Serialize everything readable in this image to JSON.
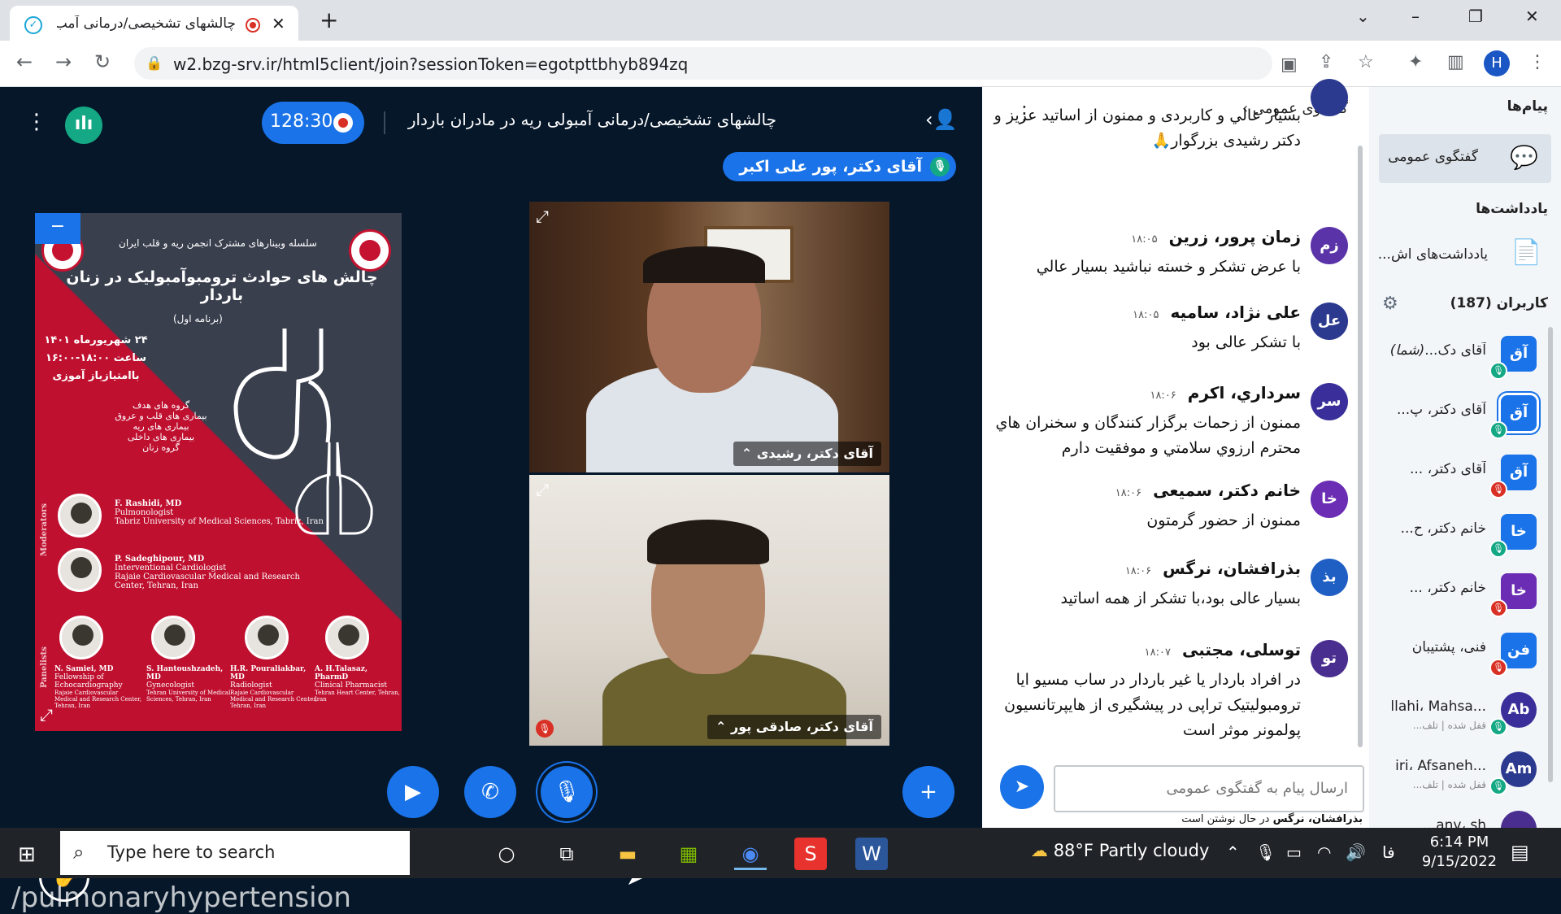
{
  "browser": {
    "tab_title": "چالشهای تشخیصی/درمانی آمب - ",
    "tab_close": "✕",
    "new_tab": "+",
    "url": "w2.bzg-srv.ir/html5client/join?sessionToken=egotpttbhyb894zq",
    "profile_initial": "H"
  },
  "header": {
    "timer": "128:30",
    "meeting_title": "چالشهای تشخیصی/درمانی آمبولی ریه در مادران باردار",
    "talker": "آقای دکتر، پور علی اکبر"
  },
  "presentation": {
    "series": "سلسله وبینارهای مشترک انجمن ریه و قلب ایران",
    "title": "چالش های حوادث ترومبوآمبولیک در زنان باردار",
    "program": "(برنامه اول)",
    "date_lines": [
      "۲۴ شهریورماه ۱۴۰۱",
      "ساعت ۱۸:۰۰-۱۶:۰۰",
      "باامتیازباز آموزی"
    ],
    "target_group_title": "گروه های هدف",
    "target_groups": [
      "بیماری های قلب و عروق",
      "بیماری های ریه",
      "بیماری های داخلی",
      "گروه زنان"
    ],
    "moderators_label": "Moderators",
    "panelists_label": "Panelists",
    "moderators": [
      {
        "name": "F. Rashidi, MD",
        "role": "Pulmonologist",
        "affil": "Tabriz University of Medical Sciences, Tabriz, Iran"
      },
      {
        "name": "P. Sadeghipour, MD",
        "role": "Interventional Cardiologist",
        "affil": "Rajaie Cardiovascular Medical and Research Center, Tehran, Iran"
      }
    ],
    "panelists": [
      {
        "name": "N. Samiei, MD",
        "role": "Fellowship of Echocardiography",
        "affil": "Rajaie Cardiovascular Medical and Research Center, Tehran, Iran"
      },
      {
        "name": "S. Hantoushzadeh, MD",
        "role": "Gynecologist",
        "affil": "Tehran University of Medical Sciences, Tehran, Iran"
      },
      {
        "name": "H.R. Pouraliakbar, MD",
        "role": "Radiologist",
        "affil": "Rajaie Cardiovascular Medical and Research Center, Tehran, Iran"
      },
      {
        "name": "A. H.Talasaz, PharmD",
        "role": "Clinical Pharmacist",
        "affil": "Tehran Heart Center, Tehran, Iran"
      }
    ]
  },
  "cameras": [
    {
      "label": "آقای دکتر، رشیدی"
    },
    {
      "label": "آقای دکتر، صادقی پور"
    }
  ],
  "watermark": "/pulmonaryhypertension",
  "chat": {
    "title": "گفتگوی عمومی",
    "messages": [
      {
        "initials": "",
        "name": "",
        "time": "",
        "text": "بسيار عالي و کاربردی و ممنون از اساتید عزیز و دکتر رشیدی بزرگوار🙏",
        "color": "#2b3a8f"
      },
      {
        "initials": "زم",
        "name": "زمان پرور، زرين",
        "time": "۱۸:۰۵",
        "text": "با عرض تشکر و خسته نباشید بسیار عالي",
        "color": "#5b33a8"
      },
      {
        "initials": "عل",
        "name": "علی نژاد، سامیه",
        "time": "۱۸:۰۵",
        "text": "با تشکر عالی بود",
        "color": "#2b3a8f"
      },
      {
        "initials": "سر",
        "name": "سرداري، اکرم",
        "time": "۱۸:۰۶",
        "text": "ممنون از زحمات برگزار کنندگان و سخنران هاي محترم ارزوي سلامتي و موفقيت دارم",
        "color": "#3a2f9a"
      },
      {
        "initials": "خا",
        "name": "خانم دکتر، سمیعی",
        "time": "۱۸:۰۶",
        "text": "ممنون از حضور گرمتون",
        "color": "#6a2db3"
      },
      {
        "initials": "بذ",
        "name": "بذرافشان، نرگس",
        "time": "۱۸:۰۶",
        "text": "بسیار عالی بود،با تشکر از همه اساتید",
        "color": "#1f5fc4"
      },
      {
        "initials": "تو",
        "name": "توسلی، مجتبی",
        "time": "۱۸:۰۷",
        "text": "در افراد باردار یا غیر باردار در ساب مسیو ایا ترومبولیتیک تراپی در پیشگیری از هایپرتانسیون پولمونر موثر است",
        "color": "#4a2e8f"
      }
    ],
    "input_placeholder": "ارسال پیام به گفتگوی عمومی",
    "typing_name": "بذرافشان، نرگس",
    "typing_suffix": "در حال نوشتن است"
  },
  "sidebar": {
    "messages_title": "پیام‌ها",
    "public_chat": "گفتگوی عمومی",
    "notes_title": "یادداشت‌ها",
    "shared_notes": "یادداشت‌های اش...",
    "users_title": "کاربران (187)",
    "users": [
      {
        "initials": "آق",
        "name": "آقای دک...",
        "you": "(شما)",
        "sub": "",
        "color": "#1a73e8",
        "status": "#15a885",
        "square": true,
        "selected": false
      },
      {
        "initials": "آق",
        "name": "آقای دکتر، پ...",
        "you": "",
        "sub": "",
        "color": "#1a73e8",
        "status": "#15a885",
        "square": true,
        "selected": true
      },
      {
        "initials": "آق",
        "name": "آقای دکتر، ...",
        "you": "",
        "sub": "",
        "color": "#1a73e8",
        "status": "#d93025",
        "square": true,
        "selected": false
      },
      {
        "initials": "خا",
        "name": "خانم دکتر، ح...",
        "you": "",
        "sub": "",
        "color": "#1a73e8",
        "status": "#15a885",
        "square": true,
        "selected": false
      },
      {
        "initials": "خا",
        "name": "خانم دکتر، ...",
        "you": "",
        "sub": "",
        "color": "#6a2db3",
        "status": "#d93025",
        "square": true,
        "selected": false
      },
      {
        "initials": "فن",
        "name": "فنی، پشتیبان",
        "you": "",
        "sub": "",
        "color": "#1a73e8",
        "status": "#d93025",
        "square": true,
        "selected": false
      },
      {
        "initials": "Ab",
        "name": "...llahi، Mahsa",
        "you": "",
        "sub": "قفل شده | تلف...",
        "color": "#3a2f9a",
        "status": "#15a885",
        "square": false,
        "selected": false
      },
      {
        "initials": "Am",
        "name": "...iri، Afsaneh",
        "you": "",
        "sub": "قفل شده | تلف...",
        "color": "#2b3a8f",
        "status": "#15a885",
        "square": false,
        "selected": false
      },
      {
        "initials": "",
        "name": "anv، sh...",
        "you": "",
        "sub": "",
        "color": "#4a2e8f",
        "status": "",
        "square": false,
        "selected": false
      }
    ]
  },
  "taskbar": {
    "search_placeholder": "Type here to search",
    "temperature": "88°F",
    "weather": "Partly cloudy",
    "lang": "فا",
    "time": "6:14 PM",
    "date": "9/15/2022"
  },
  "colors": {
    "accent": "#1a73e8",
    "dark_bg": "#06172a",
    "green": "#15a885",
    "red": "#d93025"
  }
}
